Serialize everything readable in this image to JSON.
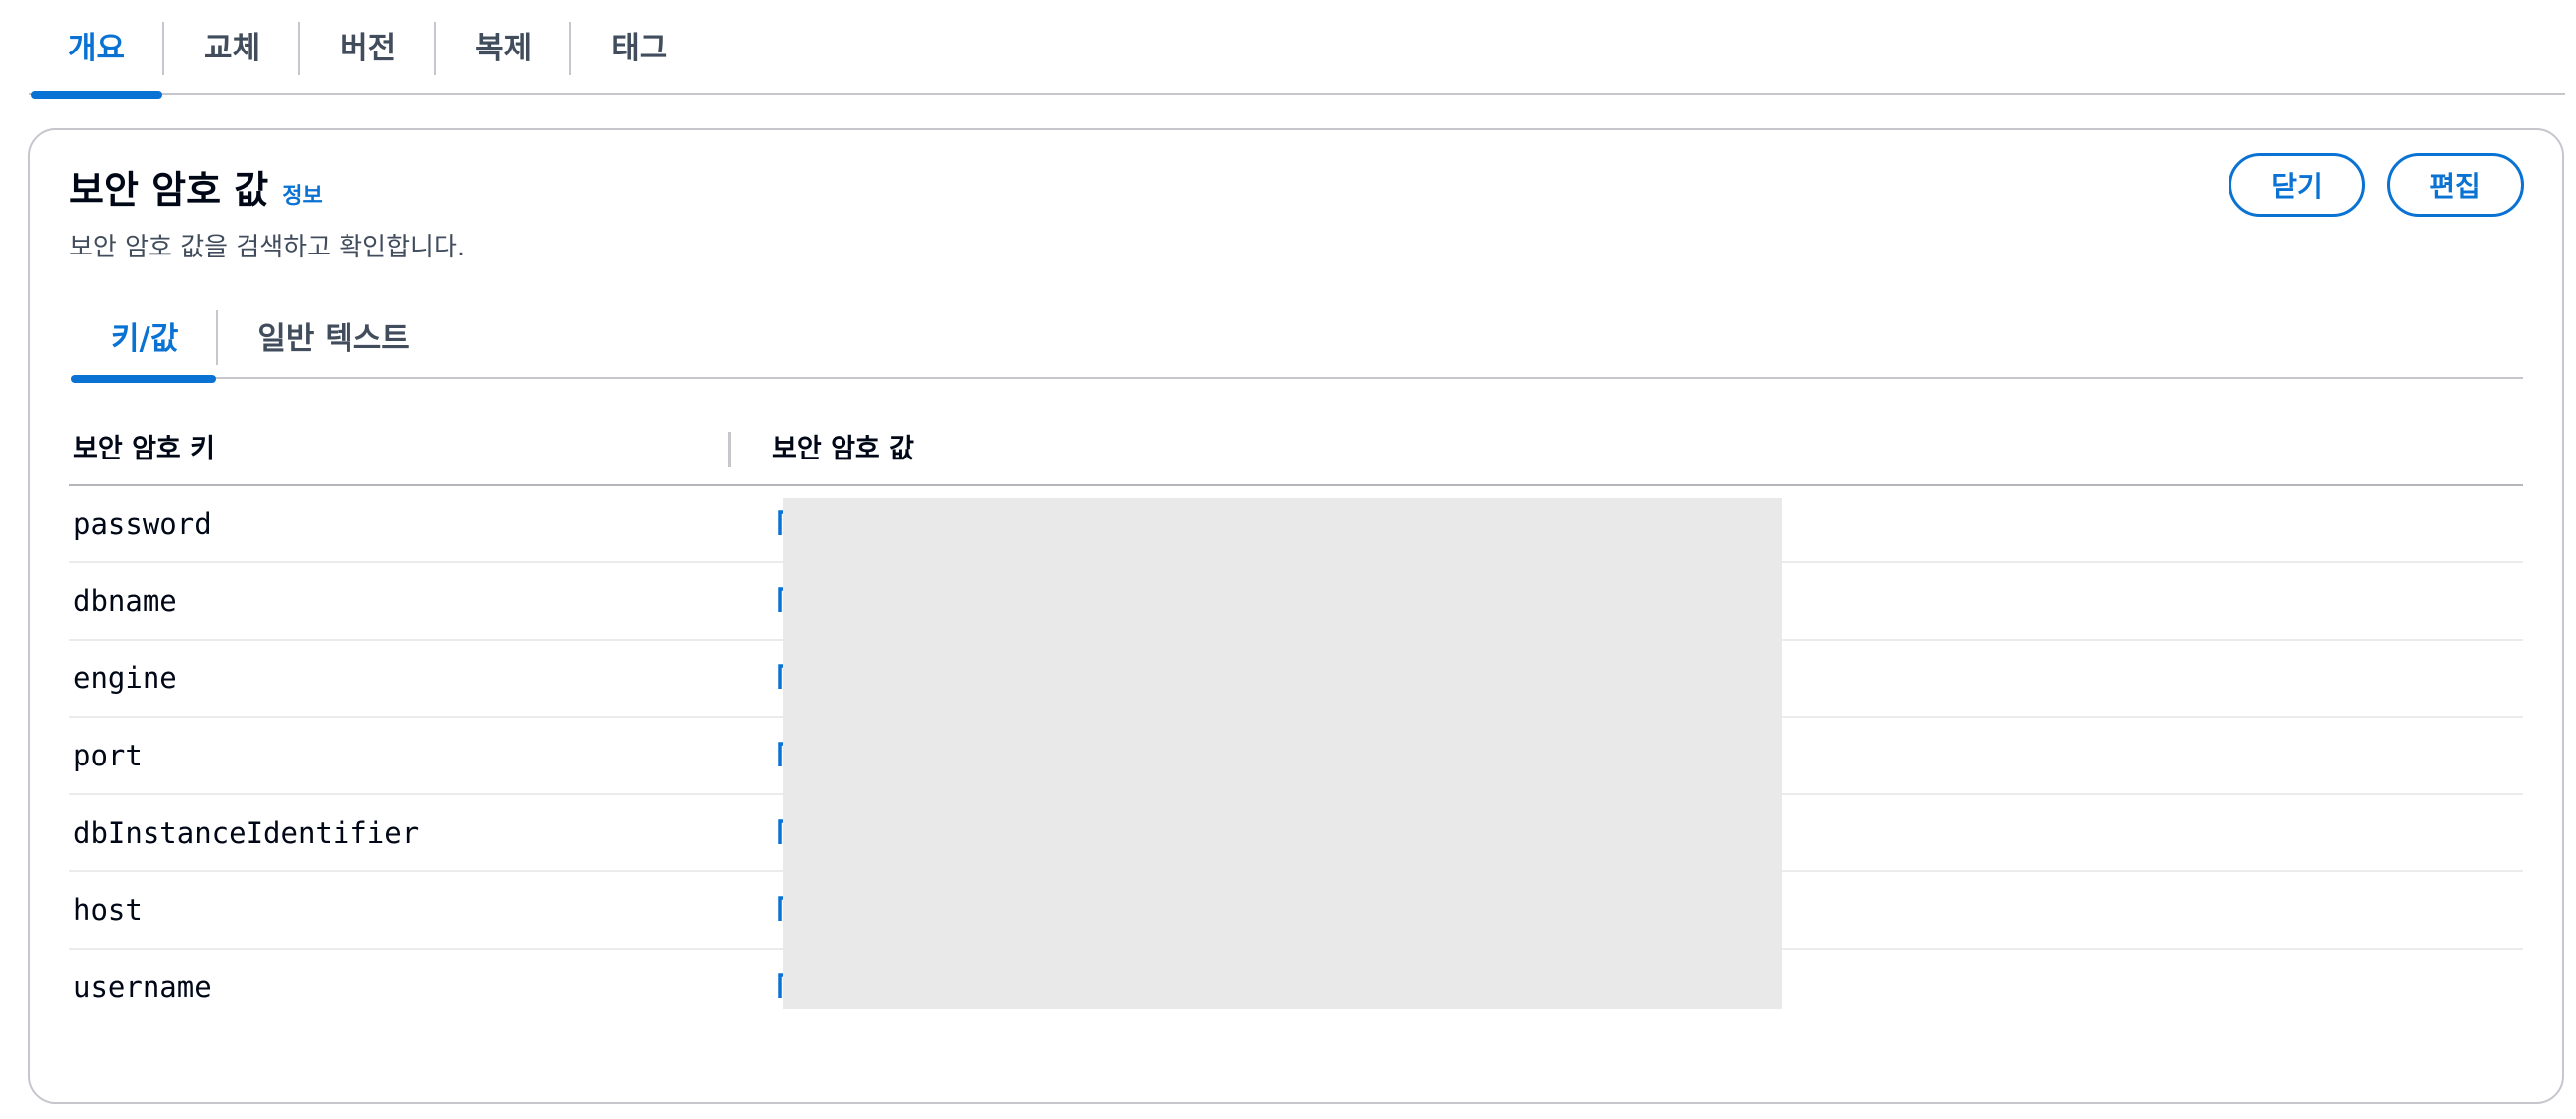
{
  "top_tabs": [
    {
      "label": "개요",
      "active": true
    },
    {
      "label": "교체",
      "active": false
    },
    {
      "label": "버전",
      "active": false
    },
    {
      "label": "복제",
      "active": false
    },
    {
      "label": "태그",
      "active": false
    }
  ],
  "card": {
    "title": "보안 암호 값",
    "info_link": "정보",
    "description": "보안 암호 값을 검색하고 확인합니다.",
    "buttons": {
      "close": "닫기",
      "edit": "편집"
    }
  },
  "inner_tabs": [
    {
      "label": "키/값",
      "active": true
    },
    {
      "label": "일반 텍스트",
      "active": false
    }
  ],
  "table": {
    "columns": {
      "key": "보안 암호 키",
      "value": "보안 암호 값"
    },
    "rows": [
      {
        "key": "password"
      },
      {
        "key": "dbname"
      },
      {
        "key": "engine"
      },
      {
        "key": "port"
      },
      {
        "key": "dbInstanceIdentifier"
      },
      {
        "key": "host"
      },
      {
        "key": "username"
      }
    ],
    "copy_icon": "copy-icon"
  },
  "colors": {
    "accent": "#0972d3",
    "border": "#c6c6cd",
    "redaction": "#e9e9e9"
  }
}
